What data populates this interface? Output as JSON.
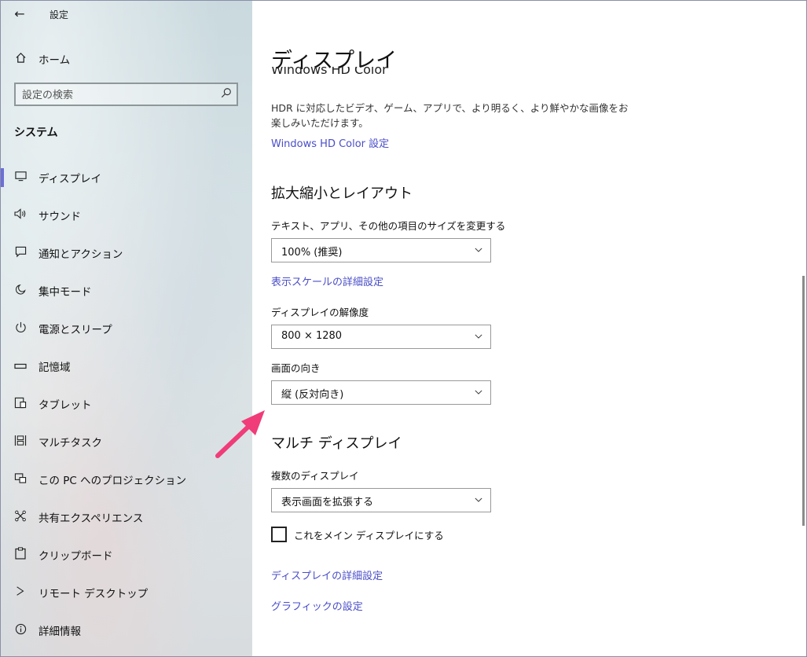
{
  "window": {
    "title": "設定",
    "controls": {
      "minimize": "—",
      "maximize": "☐",
      "close": "✕"
    }
  },
  "sidebar": {
    "back_icon": "←",
    "home": {
      "label": "ホーム",
      "icon": "home-icon"
    },
    "search": {
      "placeholder": "設定の検索",
      "icon": "search-icon"
    },
    "section_title": "システム",
    "items": [
      {
        "label": "ディスプレイ",
        "icon": "monitor-icon",
        "selected": true
      },
      {
        "label": "サウンド",
        "icon": "speaker-icon"
      },
      {
        "label": "通知とアクション",
        "icon": "notification-icon"
      },
      {
        "label": "集中モード",
        "icon": "moon-icon"
      },
      {
        "label": "電源とスリープ",
        "icon": "power-icon"
      },
      {
        "label": "記憶域",
        "icon": "storage-icon"
      },
      {
        "label": "タブレット",
        "icon": "tablet-icon"
      },
      {
        "label": "マルチタスク",
        "icon": "multitask-icon"
      },
      {
        "label": "この PC へのプロジェクション",
        "icon": "projection-icon"
      },
      {
        "label": "共有エクスペリエンス",
        "icon": "share-icon"
      },
      {
        "label": "クリップボード",
        "icon": "clipboard-icon"
      },
      {
        "label": "リモート デスクトップ",
        "icon": "remote-icon"
      },
      {
        "label": "詳細情報",
        "icon": "info-icon"
      }
    ]
  },
  "main": {
    "title": "ディスプレイ",
    "hd_color_partial": "Windows HD Color",
    "hdr_description": "HDR に対応したビデオ、ゲーム、アプリで、より明るく、より鮮やかな画像をお楽しみいただけます。",
    "hd_color_link": "Windows HD Color 設定",
    "scale_heading": "拡大縮小とレイアウト",
    "text_size_label": "テキスト、アプリ、その他の項目のサイズを変更する",
    "scale_value": "100% (推奨)",
    "advanced_scale_link": "表示スケールの詳細設定",
    "resolution_label": "ディスプレイの解像度",
    "resolution_value": "800 × 1280",
    "orientation_label": "画面の向き",
    "orientation_value": "縦 (反対向き)",
    "multi_heading": "マルチ ディスプレイ",
    "multiple_displays_label": "複数のディスプレイ",
    "multiple_displays_value": "表示画面を拡張する",
    "main_display_checkbox_label": "これをメイン ディスプレイにする",
    "main_display_checked": false,
    "advanced_display_link": "ディスプレイの詳細設定",
    "graphics_link": "グラフィックの設定"
  },
  "colors": {
    "accent": "#6b6fd6",
    "link": "#4a4ec8",
    "annotation_arrow": "#f03c78"
  }
}
